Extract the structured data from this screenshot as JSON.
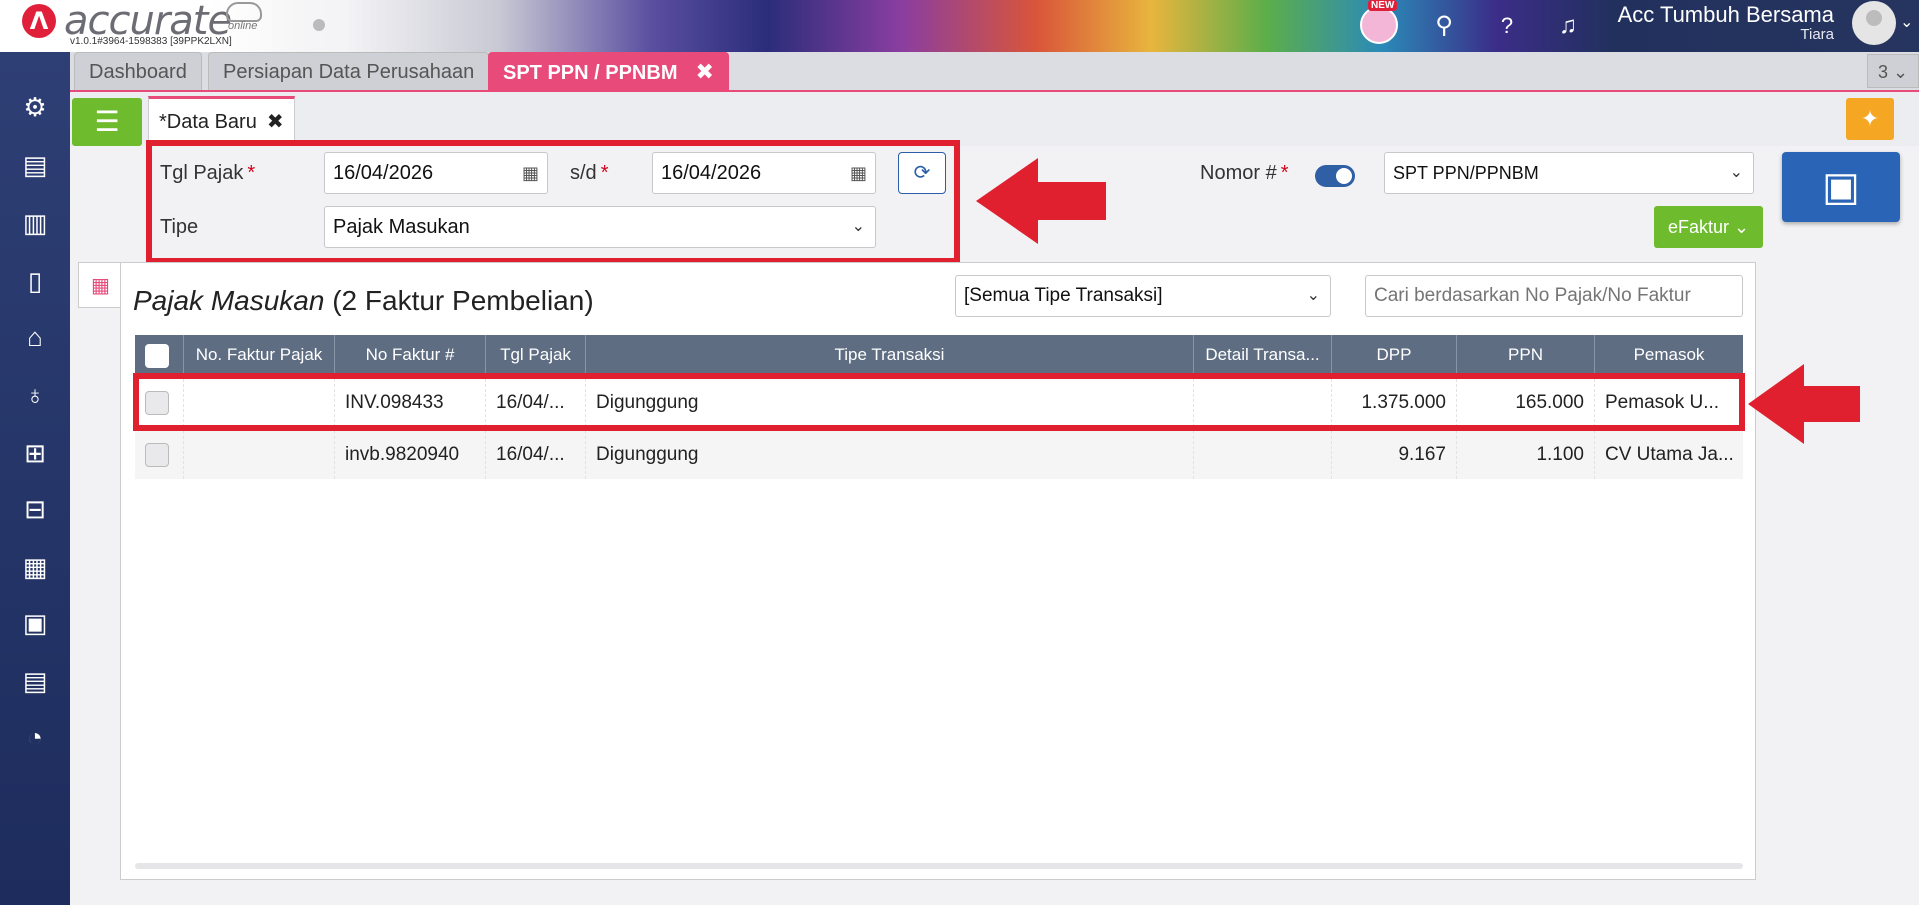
{
  "header": {
    "logo_text": "accurate",
    "logo_online": "online",
    "version": "v1.0.1#3964-1598383 [39PPK2LXN]",
    "new_badge": "NEW",
    "user_name": "Acc Tumbuh Bersama",
    "user_sub": "Tiara"
  },
  "tabs": [
    {
      "label": "Dashboard"
    },
    {
      "label": "Persiapan Data Perusahaan"
    },
    {
      "label": "SPT PPN / PPNBM",
      "close": "✖"
    }
  ],
  "tab_counter": "3 ⌄",
  "doc_tab": {
    "label": "*Data Baru",
    "close": "✖"
  },
  "form": {
    "tgl_pajak_label": "Tgl Pajak",
    "required_mark": "*",
    "date_from": "16/04/2026",
    "sd_label": "s/d",
    "date_to": "16/04/2026",
    "tipe_label": "Tipe",
    "tipe_value": "Pajak Masukan",
    "nomor_label": "Nomor #",
    "nomor_value": "SPT PPN/PPNBM",
    "efaktur_label": "eFaktur"
  },
  "grid": {
    "title_italic": "Pajak Masukan",
    "title_rest": " (2 Faktur Pembelian)",
    "filter_value": "[Semua Tipe Transaksi]",
    "search_placeholder": "Cari berdasarkan No Pajak/No Faktur",
    "columns": [
      "No. Faktur Pajak",
      "No Faktur #",
      "Tgl Pajak",
      "Tipe Transaksi",
      "Detail Transa...",
      "DPP",
      "PPN",
      "Pemasok"
    ],
    "rows": [
      {
        "no_faktur_pajak": "",
        "no_faktur": "INV.098433",
        "tgl_pajak": "16/04/...",
        "tipe": "Digunggung",
        "detail": "",
        "dpp": "1.375.000",
        "ppn": "165.000",
        "pemasok": "Pemasok U..."
      },
      {
        "no_faktur_pajak": "",
        "no_faktur": "invb.9820940",
        "tgl_pajak": "16/04/...",
        "tipe": "Digunggung",
        "detail": "",
        "dpp": "9.167",
        "ppn": "1.100",
        "pemasok": "CV Utama Ja..."
      }
    ]
  },
  "colors": {
    "accent_pink": "#e84a7a",
    "green": "#6fbb2e",
    "save_blue": "#2a64b6",
    "highlight_red": "#e0202e",
    "sidebar_navy": "#2e3f75"
  },
  "icons": {
    "sidebar": [
      "gear-icon",
      "cashier-icon",
      "building-icon",
      "ledger-icon",
      "bank-icon",
      "money-bag-icon",
      "cart-icon",
      "purchase-icon",
      "factory-icon",
      "conveyor-icon",
      "tax-icon",
      "report-icon"
    ]
  }
}
